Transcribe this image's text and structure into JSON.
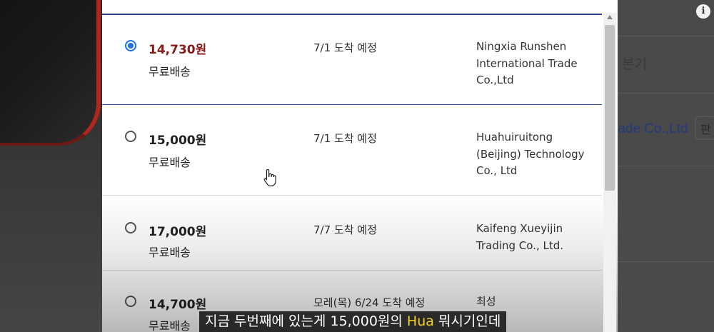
{
  "background": {
    "right_text_1": "본기",
    "right_text_2": "rade Co.,Ltd",
    "right_badge": "판"
  },
  "info_icon": "i",
  "options": [
    {
      "price": "14,730원",
      "shipping": "무료배송",
      "eta": "7/1 도착 예정",
      "seller": [
        "Ningxia Runshen",
        "International Trade",
        "Co.,Ltd"
      ],
      "selected": true
    },
    {
      "price": "15,000원",
      "shipping": "무료배송",
      "eta": "7/1 도착 예정",
      "seller": [
        "Huahuiruitong",
        "(Beijing) Technology",
        "Co., Ltd"
      ],
      "selected": false
    },
    {
      "price": "17,000원",
      "shipping": "무료배송",
      "eta": "7/7 도착 예정",
      "seller": [
        "Kaifeng Xueyijin",
        "Trading Co., Ltd."
      ],
      "selected": false
    },
    {
      "price": "14,700원",
      "shipping": "무료배송",
      "eta": "모레(목) 6/24 도착 예정",
      "seller": [
        "최성"
      ],
      "selected": false
    }
  ],
  "subtitle": {
    "before": "지금 두번째에 있는게 15,000원의 ",
    "highlight": "Hua",
    "after": " 뭐시기인데"
  },
  "colors": {
    "selected_price": "#8b1a1a",
    "radio_checked": "#1a73e8",
    "divider_selected": "#2f5597",
    "subtitle_highlight": "#f2d21c"
  }
}
